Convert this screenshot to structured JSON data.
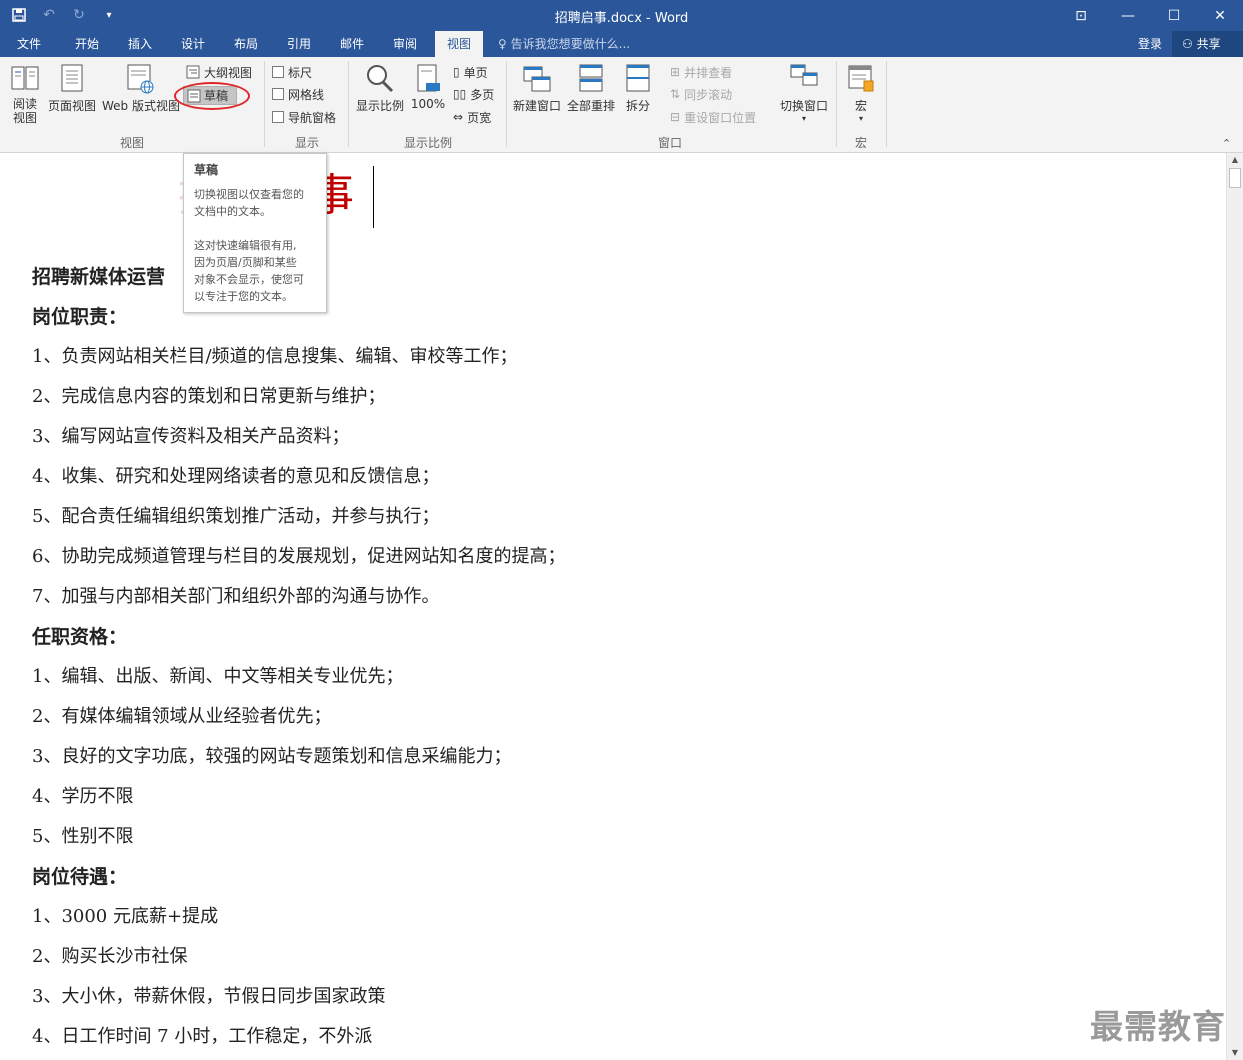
{
  "window": {
    "title": "招聘启事.docx - Word",
    "undo_icon": "undo-icon",
    "redo_icon": "redo-icon"
  },
  "tabs": [
    {
      "label": "文件"
    },
    {
      "label": "开始"
    },
    {
      "label": "插入"
    },
    {
      "label": "设计"
    },
    {
      "label": "布局"
    },
    {
      "label": "引用"
    },
    {
      "label": "邮件"
    },
    {
      "label": "审阅"
    },
    {
      "label": "视图"
    }
  ],
  "active_tab": "视图",
  "tell_me": "告诉我您想要做什么...",
  "account": {
    "login": "登录",
    "share": "共享"
  },
  "ribbon": {
    "views": {
      "group_label": "视图",
      "read_mode": "阅读\n视图",
      "print_layout": "页面视图",
      "web_layout": "Web 版式视图",
      "outline": "大纲视图",
      "draft": "草稿"
    },
    "show": {
      "group_label": "显示",
      "ruler": "标尺",
      "gridlines": "网格线",
      "nav_pane": "导航窗格"
    },
    "zoom": {
      "group_label": "显示比例",
      "zoom": "显示比例",
      "hundred": "100%",
      "one_page": "单页",
      "multi_page": "多页",
      "page_width": "页宽"
    },
    "window": {
      "group_label": "窗口",
      "new_window": "新建窗口",
      "arrange_all": "全部重排",
      "split": "拆分",
      "side_by_side": "并排查看",
      "sync_scroll": "同步滚动",
      "reset_pos": "重设窗口位置",
      "switch_windows": "切换窗口"
    },
    "macros": {
      "group_label": "宏",
      "macros": "宏"
    }
  },
  "tooltip": {
    "title": "草稿",
    "line1": "切换视图以仅查看您的",
    "line2": "文档中的文本。",
    "line3": "这对快速编辑很有用,",
    "line4": "因为页眉/页脚和某些",
    "line5": "对象不会显示，使您可",
    "line6": "以专注于您的文本。"
  },
  "document": {
    "heading_visible": "事",
    "subtitle": "招聘新媒体运营",
    "lines": [
      {
        "text": "岗位职责：",
        "bold": true
      },
      {
        "text": "1、负责网站相关栏目/频道的信息搜集、编辑、审校等工作；"
      },
      {
        "text": "2、完成信息内容的策划和日常更新与维护；"
      },
      {
        "text": "3、编写网站宣传资料及相关产品资料；"
      },
      {
        "text": "4、收集、研究和处理网络读者的意见和反馈信息；"
      },
      {
        "text": "5、配合责任编辑组织策划推广活动，并参与执行；"
      },
      {
        "text": "6、协助完成频道管理与栏目的发展规划，促进网站知名度的提高；"
      },
      {
        "text": "7、加强与内部相关部门和组织外部的沟通与协作。"
      },
      {
        "text": "任职资格：",
        "bold": true
      },
      {
        "text": "1、编辑、出版、新闻、中文等相关专业优先；"
      },
      {
        "text": "2、有媒体编辑领域从业经验者优先；"
      },
      {
        "text": "3、良好的文字功底，较强的网站专题策划和信息采编能力；"
      },
      {
        "text": "4、学历不限"
      },
      {
        "text": "5、性别不限"
      },
      {
        "text": "岗位待遇：",
        "bold": true
      },
      {
        "text": "1、3000 元底薪+提成"
      },
      {
        "text": "2、购买长沙市社保"
      },
      {
        "text": "3、大小休，带薪休假，节假日同步国家政策"
      },
      {
        "text": "4、日工作时间 7 小时，工作稳定，不外派"
      }
    ]
  },
  "watermark": "最需教育"
}
